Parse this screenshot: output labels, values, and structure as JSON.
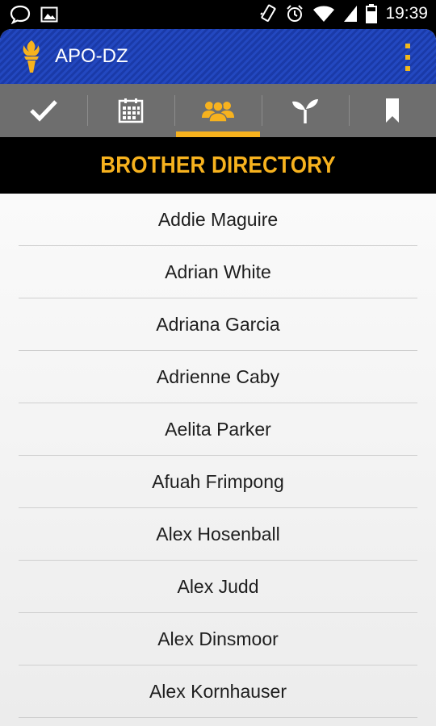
{
  "status_bar": {
    "time": "19:39",
    "icons": [
      "chat-bubble-icon",
      "image-icon",
      "vibrate-icon",
      "alarm-icon",
      "wifi-icon",
      "signal-icon",
      "battery-icon"
    ]
  },
  "app_bar": {
    "title": "APO-DZ",
    "logo_icon": "torch-icon",
    "menu_icon": "overflow-menu-icon"
  },
  "tabs": [
    {
      "icon": "checkmark-icon",
      "active": false
    },
    {
      "icon": "calendar-icon",
      "active": false
    },
    {
      "icon": "people-group-icon",
      "active": true
    },
    {
      "icon": "sprout-icon",
      "active": false
    },
    {
      "icon": "bookmark-icon",
      "active": false
    }
  ],
  "section": {
    "title": "BROTHER DIRECTORY"
  },
  "brothers": [
    "Addie Maguire",
    "Adrian White",
    "Adriana Garcia",
    "Adrienne Caby",
    "Aelita Parker",
    "Afuah Frimpong",
    "Alex Hosenball",
    "Alex Judd",
    "Alex Dinsmoor",
    "Alex Kornhauser"
  ],
  "colors": {
    "accent": "#f7b21e",
    "app_bar": "#1f43b8",
    "tab_bar": "#6e6e6e"
  }
}
